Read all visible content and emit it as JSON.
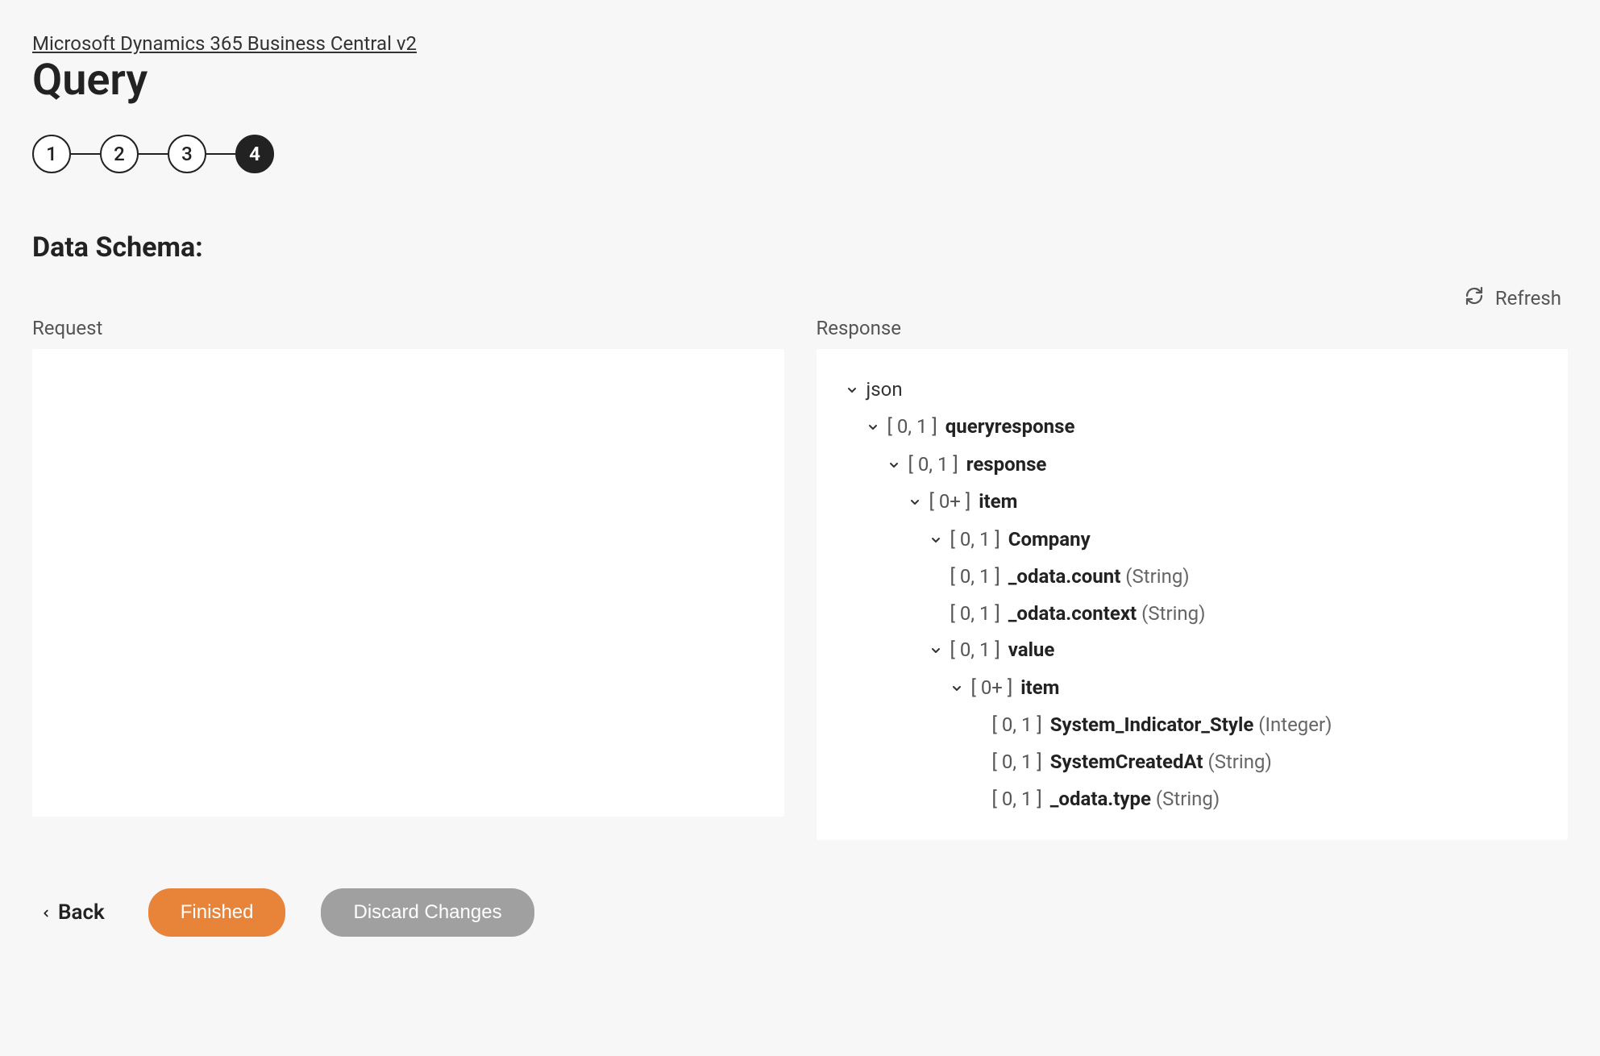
{
  "breadcrumb": "Microsoft Dynamics 365 Business Central v2",
  "page_title": "Query",
  "stepper": {
    "steps": [
      "1",
      "2",
      "3",
      "4"
    ],
    "active_index": 3
  },
  "section_title": "Data Schema:",
  "refresh_label": "Refresh",
  "request_label": "Request",
  "response_label": "Response",
  "response_tree": [
    {
      "indent": 0,
      "chevron": true,
      "card": "",
      "name": "json",
      "bold": false,
      "type": ""
    },
    {
      "indent": 1,
      "chevron": true,
      "card": "[ 0, 1 ] ",
      "name": "queryresponse",
      "bold": true,
      "type": ""
    },
    {
      "indent": 2,
      "chevron": true,
      "card": "[ 0, 1 ] ",
      "name": "response",
      "bold": true,
      "type": ""
    },
    {
      "indent": 3,
      "chevron": true,
      "card": "[ 0+ ] ",
      "name": "item",
      "bold": true,
      "type": ""
    },
    {
      "indent": 4,
      "chevron": true,
      "card": "[ 0, 1 ] ",
      "name": "Company",
      "bold": true,
      "type": ""
    },
    {
      "indent": 4,
      "chevron": false,
      "card": "[ 0, 1 ] ",
      "name": "_odata.count",
      "bold": true,
      "type": " (String)"
    },
    {
      "indent": 4,
      "chevron": false,
      "card": "[ 0, 1 ] ",
      "name": "_odata.context",
      "bold": true,
      "type": " (String)"
    },
    {
      "indent": 4,
      "chevron": true,
      "card": "[ 0, 1 ] ",
      "name": "value",
      "bold": true,
      "type": ""
    },
    {
      "indent": 5,
      "chevron": true,
      "card": "[ 0+ ] ",
      "name": "item",
      "bold": true,
      "type": ""
    },
    {
      "indent": 6,
      "chevron": false,
      "card": "[ 0, 1 ] ",
      "name": "System_Indicator_Style",
      "bold": true,
      "type": " (Integer)"
    },
    {
      "indent": 6,
      "chevron": false,
      "card": "[ 0, 1 ] ",
      "name": "SystemCreatedAt",
      "bold": true,
      "type": " (String)"
    },
    {
      "indent": 6,
      "chevron": false,
      "card": "[ 0, 1 ] ",
      "name": "_odata.type",
      "bold": true,
      "type": " (String)"
    }
  ],
  "footer": {
    "back": "Back",
    "finished": "Finished",
    "discard": "Discard Changes"
  },
  "colors": {
    "primary": "#e8833a",
    "secondary": "#a0a0a0"
  }
}
